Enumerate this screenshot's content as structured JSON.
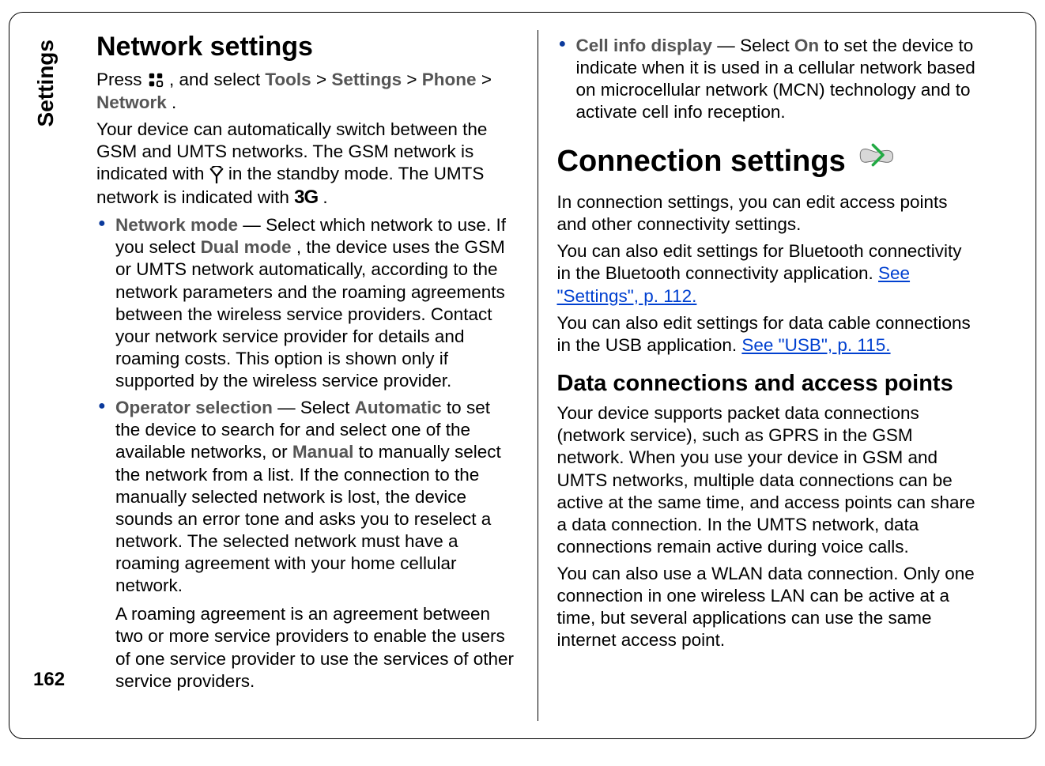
{
  "sideTab": "Settings",
  "pageNumber": "162",
  "left": {
    "title": "Network settings",
    "pressPrefix": "Press ",
    "pressMid": " , and select ",
    "navTools": "Tools",
    "navSettings": "Settings",
    "navPhone": "Phone",
    "navNetwork": "Network",
    "gt": "  >  ",
    "period": ".",
    "intro1a": "Your device can automatically switch between the GSM and UMTS networks. The GSM network is indicated with ",
    "intro1b": " in the standby mode. The UMTS network is indicated with ",
    "threeG": "3G",
    "items": [
      {
        "label": "Network mode",
        "dash": "  — ",
        "body1": "Select which network to use. If you select ",
        "dual": "Dual mode",
        "body2": ", the device uses the GSM or UMTS network automatically, according to the network parameters and the roaming agreements between the wireless service providers. Contact your network service provider for details and roaming costs. This option is shown only if supported by the wireless service provider."
      },
      {
        "label": "Operator selection",
        "dash": "  — ",
        "body1": "Select ",
        "auto": "Automatic",
        "body2": " to set the device to search for and select one of the available networks, or ",
        "manual": "Manual",
        "body3": " to manually select the network from a list. If the connection to the manually selected network is lost, the device sounds an error tone and asks you to reselect a network. The selected network must have a roaming agreement with your home cellular network.",
        "sub": "A roaming agreement is an agreement between two or more service providers to enable the users of one service provider to use the services of other service providers."
      }
    ]
  },
  "right": {
    "items": [
      {
        "label": "Cell info display",
        "dash": "  — ",
        "body1": "Select ",
        "on": "On",
        "body2": " to set the device to indicate when it is used in a cellular network based on microcellular network (MCN) technology and to activate cell info reception."
      }
    ],
    "connTitle": "Connection settings",
    "connIntro": "In connection settings, you can edit access points and other connectivity settings.",
    "bt1": "You can also edit settings for Bluetooth connectivity in the Bluetooth connectivity application. ",
    "btLink": "See \"Settings\", p. 112.",
    "usb1": "You can also edit settings for data cable connections in the USB application. ",
    "usbLink": "See \"USB\", p. 115.",
    "dataTitle": "Data connections and access points",
    "dataP1": "Your device supports packet data connections (network service), such as GPRS in the GSM network. When you use your device in GSM and UMTS networks, multiple data connections can be active at the same time, and access points can share a data connection. In the UMTS network, data connections remain active during voice calls.",
    "dataP2": "You can also use a WLAN data connection. Only one connection in one wireless LAN can be active at a time, but several applications can use the same internet access point."
  }
}
